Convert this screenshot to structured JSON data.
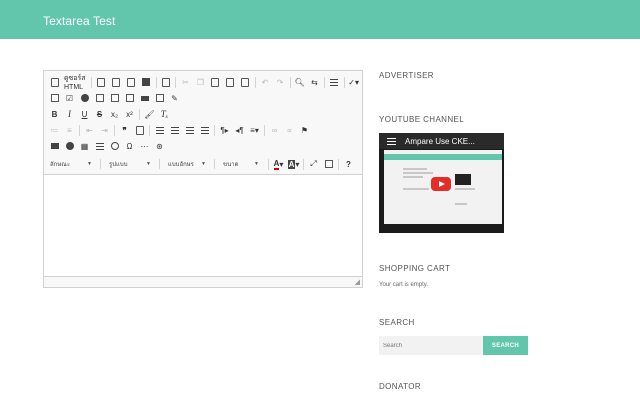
{
  "header": {
    "site_title": "Textarea Test"
  },
  "editor": {
    "source_label": "ดูซอร์ส HTML",
    "format_combo": "ลักษณะ",
    "style_combo": "รูปแบบ",
    "font_combo": "แบบอักษร",
    "size_combo": "ขนาด",
    "help_label": "?",
    "resize_glyph": "◢"
  },
  "sidebar": {
    "advertiser_title": "ADVERTISER",
    "youtube_title": "YOUTUBE CHANNEL",
    "video_title": "Ampare Use CKE...",
    "cart_title": "SHOPPING CART",
    "cart_text": "Your cart is empty.",
    "search_title": "SEARCH",
    "search_placeholder": "Search",
    "search_button": "SEARCH",
    "donator_title": "DONATOR"
  },
  "colors": {
    "accent": "#62c6ad",
    "play": "#e52d27"
  },
  "icons": [
    "source-icon",
    "save-icon",
    "new-page-icon",
    "preview-icon",
    "print-icon",
    "templates-icon",
    "cut-icon",
    "copy-icon",
    "paste-icon",
    "paste-text-icon",
    "paste-word-icon",
    "undo-icon",
    "redo-icon",
    "find-icon",
    "replace-icon",
    "select-all-icon",
    "spellcheck-icon",
    "form-icon",
    "checkbox-icon",
    "radio-icon",
    "textfield-icon",
    "textarea-icon",
    "select-icon",
    "button-icon",
    "image-button-icon",
    "hidden-field-icon",
    "bold-icon",
    "italic-icon",
    "underline-icon",
    "strike-icon",
    "subscript-icon",
    "superscript-icon",
    "copy-format-icon",
    "remove-format-icon",
    "numbered-list-icon",
    "bulleted-list-icon",
    "outdent-icon",
    "indent-icon",
    "blockquote-icon",
    "div-icon",
    "align-left-icon",
    "align-center-icon",
    "align-right-icon",
    "justify-icon",
    "ltr-icon",
    "rtl-icon",
    "language-icon",
    "link-icon",
    "unlink-icon",
    "anchor-icon",
    "image-icon",
    "flash-icon",
    "table-icon",
    "horizontal-line-icon",
    "smiley-icon",
    "special-char-icon",
    "page-break-icon",
    "iframe-icon",
    "text-color-icon",
    "bg-color-icon",
    "maximize-icon",
    "show-blocks-icon",
    "help-icon"
  ]
}
